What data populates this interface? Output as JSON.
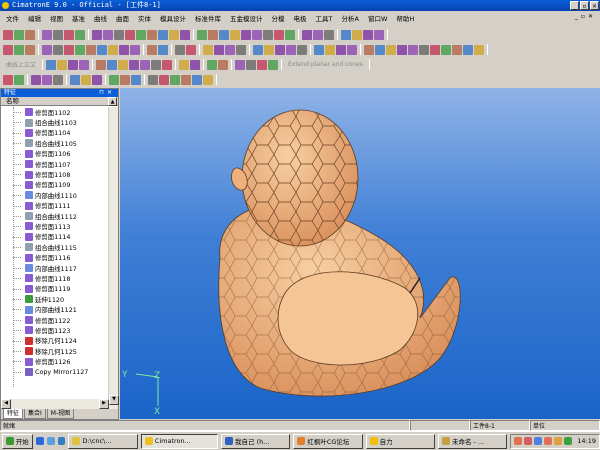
{
  "window": {
    "title": "CimatronE 9.0 - Official - [工件8-1]",
    "controls": [
      "_",
      "▫",
      "✕"
    ]
  },
  "menu": [
    "文件",
    "编辑",
    "视图",
    "基准",
    "曲线",
    "曲面",
    "实体",
    "模具设计",
    "标准件库",
    "五金模设计",
    "分模",
    "电极",
    "工具T",
    "分析A",
    "窗口W",
    "帮助H"
  ],
  "toolbar": {
    "disabled_label_1": "曲线上立文",
    "disabled_label_2": "Extend planar and cones"
  },
  "panel": {
    "title": "特征",
    "column_header": "名称",
    "items": [
      {
        "label": "修剪面1102",
        "icon": "trim-surface-icon"
      },
      {
        "label": "组合曲线1103",
        "icon": "composite-curve-icon"
      },
      {
        "label": "修剪面1104",
        "icon": "trim-surface-icon"
      },
      {
        "label": "组合曲线1105",
        "icon": "composite-curve-icon"
      },
      {
        "label": "修剪面1106",
        "icon": "trim-surface-icon"
      },
      {
        "label": "修剪面1107",
        "icon": "trim-surface-icon"
      },
      {
        "label": "修剪面1108",
        "icon": "trim-surface-icon"
      },
      {
        "label": "修剪面1109",
        "icon": "trim-surface-icon"
      },
      {
        "label": "内部曲线1110",
        "icon": "inner-curve-icon"
      },
      {
        "label": "修剪面1111",
        "icon": "trim-surface-icon"
      },
      {
        "label": "组合曲线1112",
        "icon": "composite-curve-icon"
      },
      {
        "label": "修剪面1113",
        "icon": "trim-surface-icon"
      },
      {
        "label": "修剪面1114",
        "icon": "trim-surface-icon"
      },
      {
        "label": "组合曲线1115",
        "icon": "composite-curve-icon"
      },
      {
        "label": "修剪面1116",
        "icon": "trim-surface-icon"
      },
      {
        "label": "内部曲线1117",
        "icon": "inner-curve-icon"
      },
      {
        "label": "修剪面1118",
        "icon": "trim-surface-icon"
      },
      {
        "label": "修剪面1119",
        "icon": "trim-surface-icon"
      },
      {
        "label": "延伸1120",
        "icon": "extend-icon"
      },
      {
        "label": "内部曲线1121",
        "icon": "inner-curve-icon"
      },
      {
        "label": "修剪面1122",
        "icon": "trim-surface-icon"
      },
      {
        "label": "修剪面1123",
        "icon": "trim-surface-icon"
      },
      {
        "label": "移除几何1124",
        "icon": "remove-geometry-icon"
      },
      {
        "label": "移除几何1125",
        "icon": "remove-geometry-icon"
      },
      {
        "label": "修剪面1126",
        "icon": "trim-surface-icon"
      },
      {
        "label": "Copy Mirror1127",
        "icon": "copy-mirror-icon"
      }
    ],
    "tabs": [
      "特征",
      "集合I",
      "M-视图"
    ]
  },
  "viewport": {
    "axes": {
      "y": "Y",
      "z": "Z",
      "x": "X"
    }
  },
  "status": {
    "left": "就绪",
    "part": "工件8-1",
    "unit": "单位"
  },
  "taskbar": {
    "start": "开始",
    "buttons": [
      "D:\\cnc\\...",
      "Cimatron...",
      "我自己 (h...",
      "红枫叶CG论坛",
      "自力",
      "未命名 - ..."
    ],
    "active_index": 1,
    "clock": "14:19"
  }
}
